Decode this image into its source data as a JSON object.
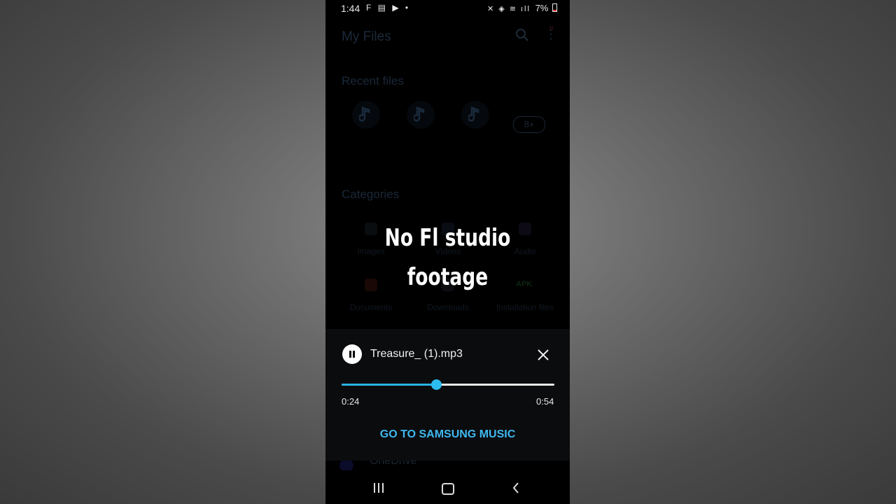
{
  "status_bar": {
    "time": "1:44",
    "left_icons": "F ▤ ▶ •",
    "right_icons": "✕ ◈ ≋ ıll",
    "battery": "7%"
  },
  "files_app": {
    "title": "My Files",
    "more_badge": "N",
    "recent_label": "Recent files",
    "recent_more": "8+",
    "categories_label": "Categories",
    "categories": [
      "Images",
      "Videos",
      "Audio",
      "Documents",
      "Downloads",
      "Installation files"
    ],
    "apk_label": "APK",
    "onedrive_label": "OneDrive"
  },
  "caption": {
    "line1": "No Fl studio",
    "line2": "footage"
  },
  "player": {
    "track_name": "Treasure_ (1).mp3",
    "elapsed": "0:24",
    "total": "0:54",
    "progress": 0.444,
    "go_to_music": "GO TO SAMSUNG MUSIC"
  },
  "colors": {
    "accent": "#2cbdf0",
    "link": "#3eb8ef"
  }
}
